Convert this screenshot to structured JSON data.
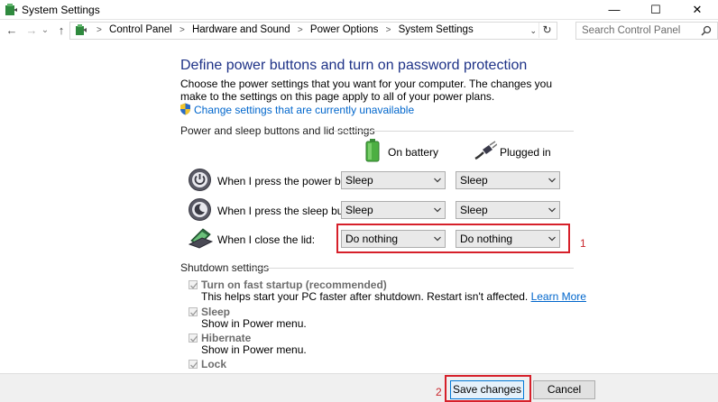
{
  "window": {
    "title": "System Settings",
    "minimize": "—",
    "maximize": "☐",
    "close": "✕"
  },
  "nav": {
    "back": "←",
    "forward": "→",
    "history": "⌄",
    "up": "↑",
    "breadcrumbs": [
      "Control Panel",
      "Hardware and Sound",
      "Power Options",
      "System Settings"
    ],
    "search_placeholder": "Search Control Panel"
  },
  "main": {
    "title": "Define power buttons and turn on password protection",
    "description": "Choose the power settings that you want for your computer. The changes you make to the settings on this page apply to all of your power plans.",
    "change_link": "Change settings that are currently unavailable",
    "power_section": {
      "heading": "Power and sleep buttons and lid settings",
      "columns": [
        "On battery",
        "Plugged in"
      ],
      "rows": [
        {
          "label": "When I press the power button:",
          "battery": "Sleep",
          "plugged": "Sleep"
        },
        {
          "label": "When I press the sleep button:",
          "battery": "Sleep",
          "plugged": "Sleep"
        },
        {
          "label": "When I close the lid:",
          "battery": "Do nothing",
          "plugged": "Do nothing"
        }
      ]
    },
    "shutdown_section": {
      "heading": "Shutdown settings",
      "items": [
        {
          "label": "Turn on fast startup (recommended)",
          "desc": "This helps start your PC faster after shutdown. Restart isn't affected.",
          "link": "Learn More",
          "checked": true
        },
        {
          "label": "Sleep",
          "desc": "Show in Power menu.",
          "checked": true
        },
        {
          "label": "Hibernate",
          "desc": "Show in Power menu.",
          "checked": true
        },
        {
          "label": "Lock",
          "checked": true
        }
      ]
    }
  },
  "annotations": {
    "callout_1": "1",
    "callout_2": "2"
  },
  "footer": {
    "save": "Save changes",
    "cancel": "Cancel"
  },
  "colors": {
    "title_blue": "#1e3287",
    "link_blue": "#0066cc",
    "highlight_red": "#d6202a"
  }
}
